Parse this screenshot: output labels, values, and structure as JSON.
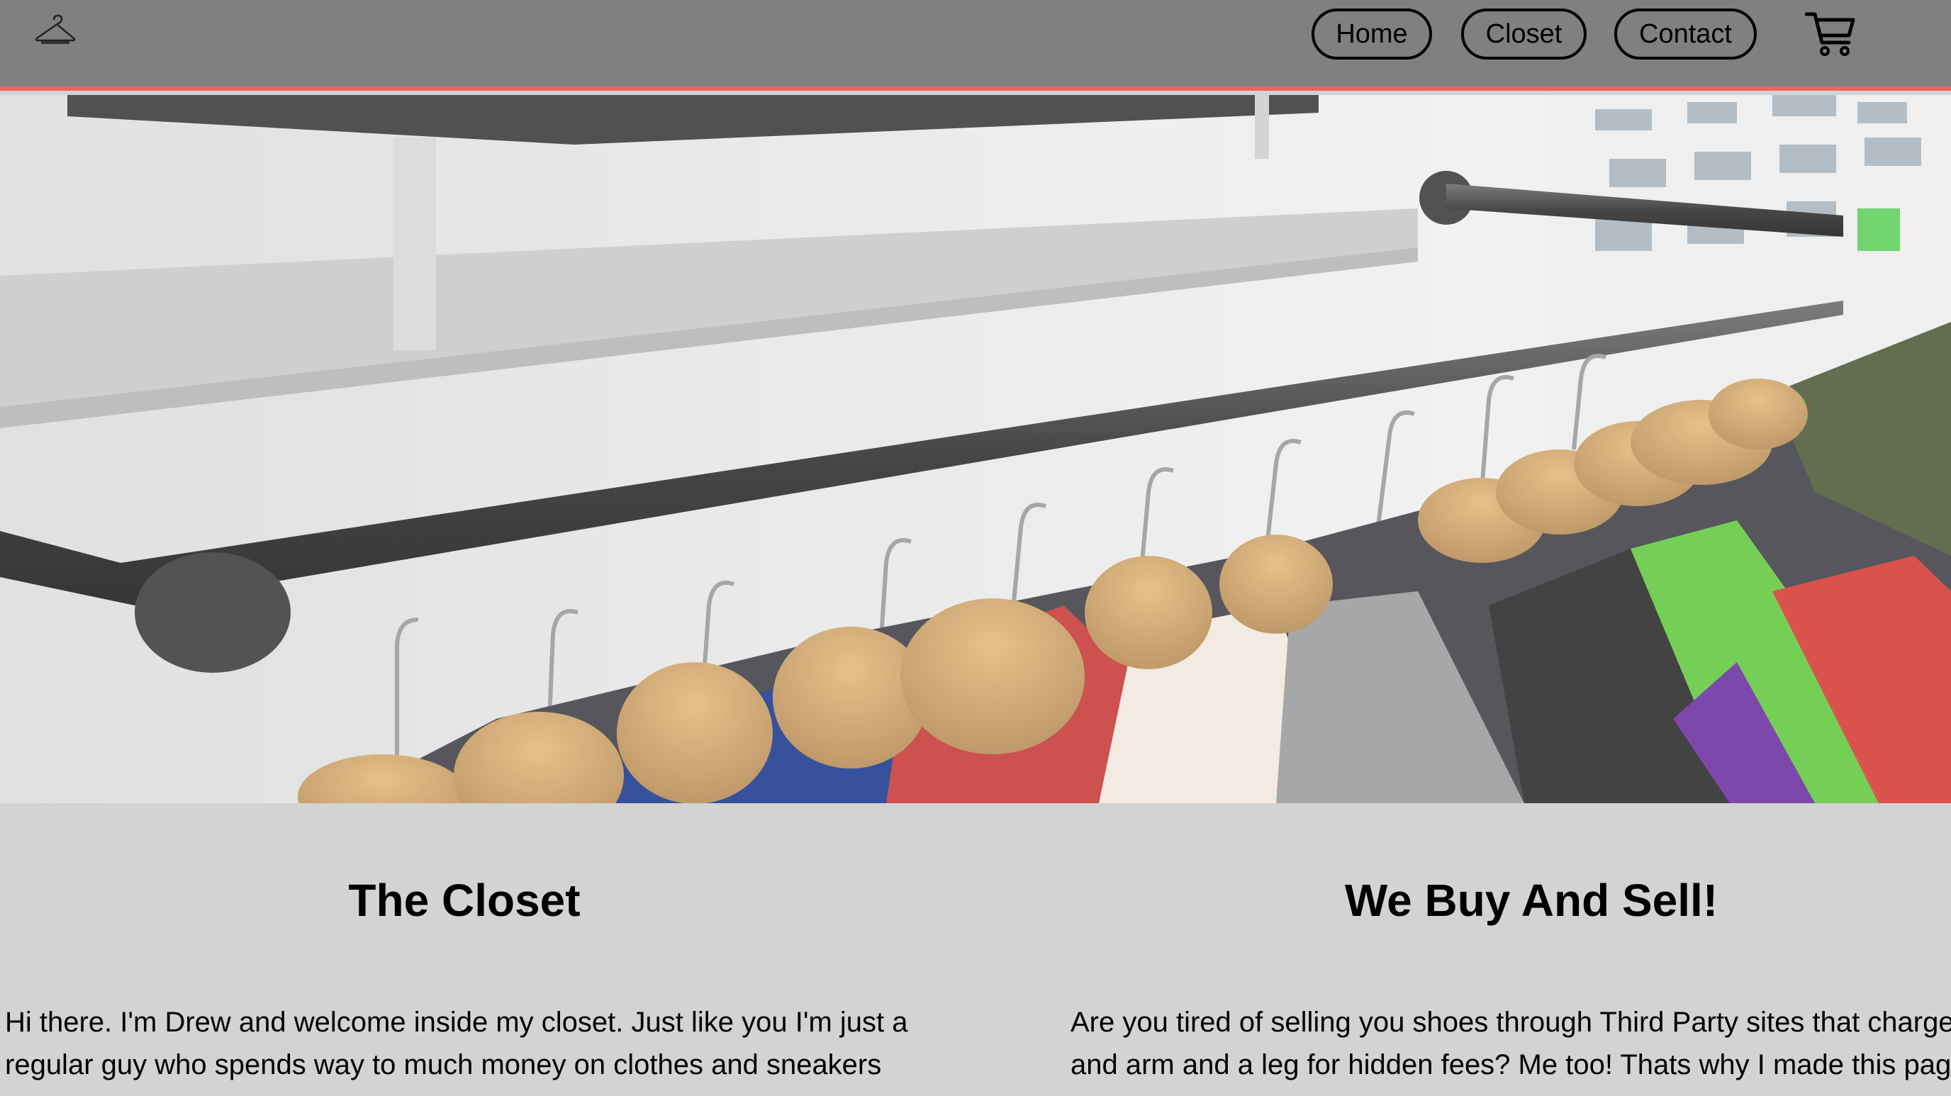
{
  "header": {
    "logo_icon": "hanger-logo-icon",
    "nav": {
      "home_label": "Home",
      "closet_label": "Closet",
      "contact_label": "Contact"
    },
    "cart_icon": "shopping-cart-icon"
  },
  "hero": {
    "image": "clothing-rack-photo"
  },
  "sections": {
    "left": {
      "title": "The Closet",
      "line1": "Hi there. I'm Drew and welcome inside my closet. Just like you I'm just a",
      "line2": "regular guy who spends way to much money on clothes and sneakers"
    },
    "right": {
      "title": "We Buy And Sell!",
      "line1": "Are you tired of selling you shoes through Third Party sites that charge",
      "line2": "and arm and a leg for hidden fees? Me too! Thats why I made this pag"
    }
  },
  "colors": {
    "header_bg": "#808080",
    "header_border": "#e8665f",
    "page_bg": "#d3d3d3"
  }
}
